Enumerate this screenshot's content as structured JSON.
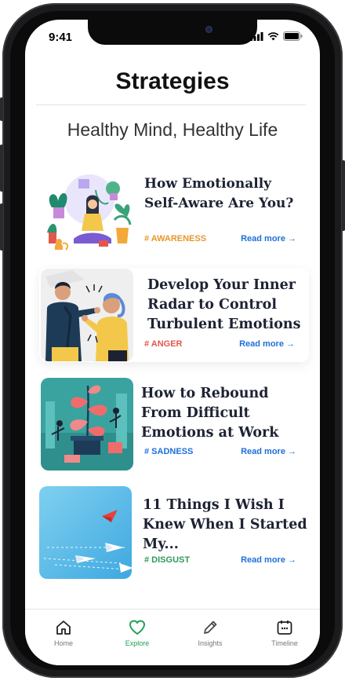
{
  "status": {
    "time": "9:41"
  },
  "header": {
    "title": "Strategies"
  },
  "section": {
    "subtitle": "Healthy Mind, Healthy Life"
  },
  "cards": [
    {
      "title": "How Emotionally Self-Aware Are You?",
      "tag": "# AWARENESS",
      "tag_color": "#e8962e",
      "read_more": "Read more →"
    },
    {
      "title": "Develop Your Inner Radar to Control Turbulent Emotions",
      "tag": "# ANGER",
      "tag_color": "#e2574c",
      "read_more": "Read more →"
    },
    {
      "title": "How to Rebound From Difficult Emotions at Work",
      "tag": "# SADNESS",
      "tag_color": "#1e6fd8",
      "read_more": "Read more →"
    },
    {
      "title": "11 Things I Wish I Knew When I Started My...",
      "tag": "# DISGUST",
      "tag_color": "#2e9a5a",
      "read_more": "Read more →"
    }
  ],
  "tabbar": {
    "items": [
      {
        "label": "Home",
        "icon": "home-icon"
      },
      {
        "label": "Explore",
        "icon": "heart-icon"
      },
      {
        "label": "Insights",
        "icon": "pencil-icon"
      },
      {
        "label": "Timeline",
        "icon": "calendar-icon"
      }
    ],
    "active_color": "#1f9d55"
  }
}
